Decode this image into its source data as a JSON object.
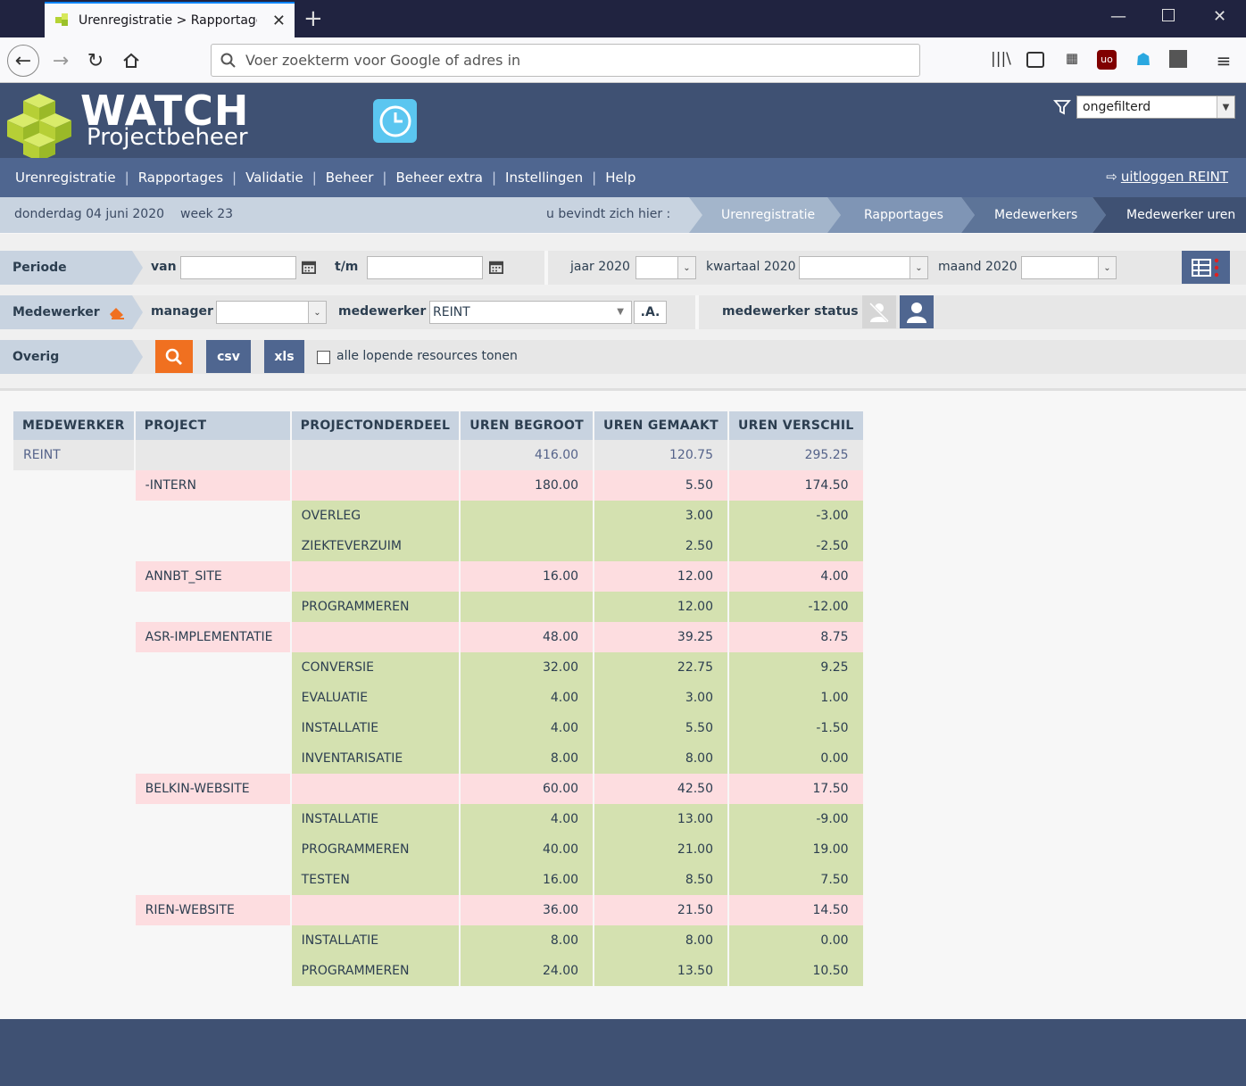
{
  "browser": {
    "tab_title": "Urenregistratie > Rapportages",
    "url_placeholder": "Voer zoekterm voor Google of adres in"
  },
  "header": {
    "logo_title": "WATCH",
    "logo_subtitle": "Projectbeheer",
    "filter_value": "ongefilterd"
  },
  "menu": {
    "items": [
      "Urenregistratie",
      "Rapportages",
      "Validatie",
      "Beheer",
      "Beheer extra",
      "Instellingen",
      "Help"
    ],
    "logout": "uitloggen REINT"
  },
  "crumbbar": {
    "date": "donderdag 04 juni 2020",
    "week": "week 23",
    "here_label": "u bevindt zich hier :",
    "crumbs": [
      "Urenregistratie",
      "Rapportages",
      "Medewerkers",
      "Medewerker uren"
    ]
  },
  "filters": {
    "periode_label": "Periode",
    "van_label": "van",
    "van_value": "",
    "tm_label": "t/m",
    "tm_value": "",
    "jaar_label": "jaar 2020",
    "kwartaal_label": "kwartaal 2020",
    "maand_label": "maand 2020",
    "medewerker_section_label": "Medewerker",
    "manager_label": "manager",
    "manager_value": "",
    "medewerker_label": "medewerker",
    "medewerker_value": "REINT",
    "a_button": ".A.",
    "status_label": "medewerker status",
    "overig_label": "Overig",
    "csv_label": "csv",
    "xls_label": "xls",
    "checkbox_label": "alle lopende resources tonen",
    "checkbox_checked": false
  },
  "table": {
    "headers": [
      "MEDEWERKER",
      "PROJECT",
      "PROJECTONDERDEEL",
      "UREN BEGROOT",
      "UREN GEMAAKT",
      "UREN VERSCHIL"
    ],
    "rows": [
      {
        "level": "emp",
        "medewerker": "REINT",
        "project": "",
        "onderdeel": "",
        "begroot": "416.00",
        "gemaakt": "120.75",
        "verschil": "295.25"
      },
      {
        "level": "proj",
        "project": "-INTERN",
        "onderdeel": "",
        "begroot": "180.00",
        "gemaakt": "5.50",
        "verschil": "174.50"
      },
      {
        "level": "part",
        "onderdeel": "OVERLEG",
        "begroot": "",
        "gemaakt": "3.00",
        "verschil": "-3.00"
      },
      {
        "level": "part",
        "onderdeel": "ZIEKTEVERZUIM",
        "begroot": "",
        "gemaakt": "2.50",
        "verschil": "-2.50"
      },
      {
        "level": "proj",
        "project": "ANNBT_SITE",
        "onderdeel": "",
        "begroot": "16.00",
        "gemaakt": "12.00",
        "verschil": "4.00"
      },
      {
        "level": "part",
        "onderdeel": "PROGRAMMEREN",
        "begroot": "",
        "gemaakt": "12.00",
        "verschil": "-12.00"
      },
      {
        "level": "proj",
        "project": "ASR-IMPLEMENTATIE",
        "onderdeel": "",
        "begroot": "48.00",
        "gemaakt": "39.25",
        "verschil": "8.75"
      },
      {
        "level": "part",
        "onderdeel": "CONVERSIE",
        "begroot": "32.00",
        "gemaakt": "22.75",
        "verschil": "9.25"
      },
      {
        "level": "part",
        "onderdeel": "EVALUATIE",
        "begroot": "4.00",
        "gemaakt": "3.00",
        "verschil": "1.00"
      },
      {
        "level": "part",
        "onderdeel": "INSTALLATIE",
        "begroot": "4.00",
        "gemaakt": "5.50",
        "verschil": "-1.50"
      },
      {
        "level": "part",
        "onderdeel": "INVENTARISATIE",
        "begroot": "8.00",
        "gemaakt": "8.00",
        "verschil": "0.00"
      },
      {
        "level": "proj",
        "project": "BELKIN-WEBSITE",
        "onderdeel": "",
        "begroot": "60.00",
        "gemaakt": "42.50",
        "verschil": "17.50"
      },
      {
        "level": "part",
        "onderdeel": "INSTALLATIE",
        "begroot": "4.00",
        "gemaakt": "13.00",
        "verschil": "-9.00"
      },
      {
        "level": "part",
        "onderdeel": "PROGRAMMEREN",
        "begroot": "40.00",
        "gemaakt": "21.00",
        "verschil": "19.00"
      },
      {
        "level": "part",
        "onderdeel": "TESTEN",
        "begroot": "16.00",
        "gemaakt": "8.50",
        "verschil": "7.50"
      },
      {
        "level": "proj",
        "project": "RIEN-WEBSITE",
        "onderdeel": "",
        "begroot": "36.00",
        "gemaakt": "21.50",
        "verschil": "14.50"
      },
      {
        "level": "part",
        "onderdeel": "INSTALLATIE",
        "begroot": "8.00",
        "gemaakt": "8.00",
        "verschil": "0.00"
      },
      {
        "level": "part",
        "onderdeel": "PROGRAMMEREN",
        "begroot": "24.00",
        "gemaakt": "13.50",
        "verschil": "10.50"
      }
    ]
  },
  "colors": {
    "header_bg": "#3f5173",
    "menu_bg": "#4f6690",
    "accent_orange": "#f07020",
    "project_row": "#fddde0",
    "part_row": "#d4e1b0"
  }
}
